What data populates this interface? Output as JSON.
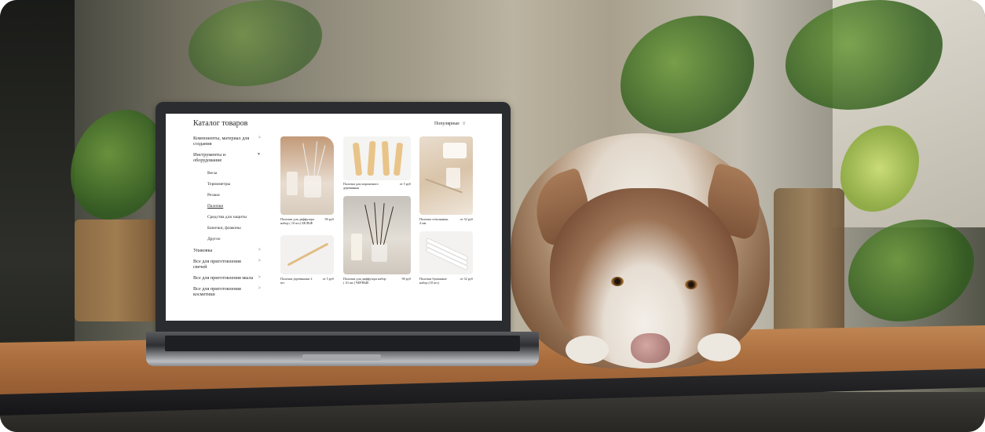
{
  "catalog": {
    "title": "Каталог товаров",
    "sort": {
      "label": "Популярные",
      "icon": "chevron-down-icon"
    }
  },
  "sidebar": {
    "items": [
      {
        "label": "Компоненты, материал для создания",
        "arrow": ">"
      },
      {
        "label": "Инструменты и оборудование",
        "arrow": "▼"
      }
    ],
    "subitems": [
      "Весы",
      "Термометры",
      "Резаки",
      "Палочки",
      "Средства для защиты",
      "Баночки, флаконы",
      "Другое"
    ],
    "active_subitem": "Палочки",
    "items_after": [
      {
        "label": "Упаковка",
        "arrow": ">"
      },
      {
        "label": "Все для приготовления свечей",
        "arrow": ">"
      },
      {
        "label": "Все для приготовления мыла",
        "arrow": ">"
      },
      {
        "label": "Все для приготовления косметики",
        "arrow": ">"
      }
    ]
  },
  "products": [
    {
      "name": "Палочки для диффузора набор ( 10 шт.) БЕЛЫЕ",
      "price": "90 руб"
    },
    {
      "name": "Палочка для мороженого деревянная",
      "price": "от 5 руб"
    },
    {
      "name": "Палочка стеклянная, 4 мм",
      "price": "от 32 руб"
    },
    {
      "name": "Палочки деревянные 2 шт",
      "price": "от 5 руб"
    },
    {
      "name": "Палочки для диффузора набор ( 10 шт.) ЧЕРНЫЕ",
      "price": "90 руб"
    },
    {
      "name": "Палочки бумажные набор (10 шт.)",
      "price": "от 32 руб"
    }
  ]
}
